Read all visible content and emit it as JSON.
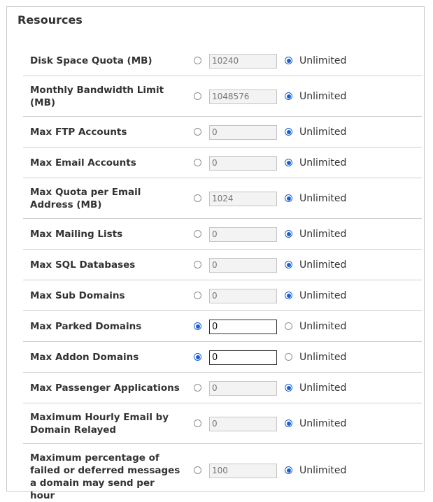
{
  "panel": {
    "title": "Resources",
    "unlimited_label": "Unlimited",
    "rows": [
      {
        "label": "Disk Space Quota (MB)",
        "value": "10240",
        "mode": "unlimited"
      },
      {
        "label": "Monthly Bandwidth Limit (MB)",
        "value": "1048576",
        "mode": "unlimited"
      },
      {
        "label": "Max FTP Accounts",
        "value": "0",
        "mode": "unlimited"
      },
      {
        "label": "Max Email Accounts",
        "value": "0",
        "mode": "unlimited"
      },
      {
        "label": "Max Quota per Email Address (MB)",
        "value": "1024",
        "mode": "unlimited"
      },
      {
        "label": "Max Mailing Lists",
        "value": "0",
        "mode": "unlimited"
      },
      {
        "label": "Max SQL Databases",
        "value": "0",
        "mode": "unlimited"
      },
      {
        "label": "Max Sub Domains",
        "value": "0",
        "mode": "unlimited"
      },
      {
        "label": "Max Parked Domains",
        "value": "0",
        "mode": "value"
      },
      {
        "label": "Max Addon Domains",
        "value": "0",
        "mode": "value"
      },
      {
        "label": "Max Passenger Applications",
        "value": "0",
        "mode": "unlimited"
      },
      {
        "label": "Maximum Hourly Email by Domain Relayed",
        "value": "0",
        "mode": "unlimited"
      },
      {
        "label": "Maximum percentage of failed or deferred messages a domain may send per hour",
        "value": "100",
        "mode": "unlimited"
      }
    ]
  },
  "colors": {
    "accent": "#1a5fd0",
    "border": "#c8c8c8",
    "divider": "#cfcfcf",
    "disabled_field_bg": "#f3f3f3"
  }
}
